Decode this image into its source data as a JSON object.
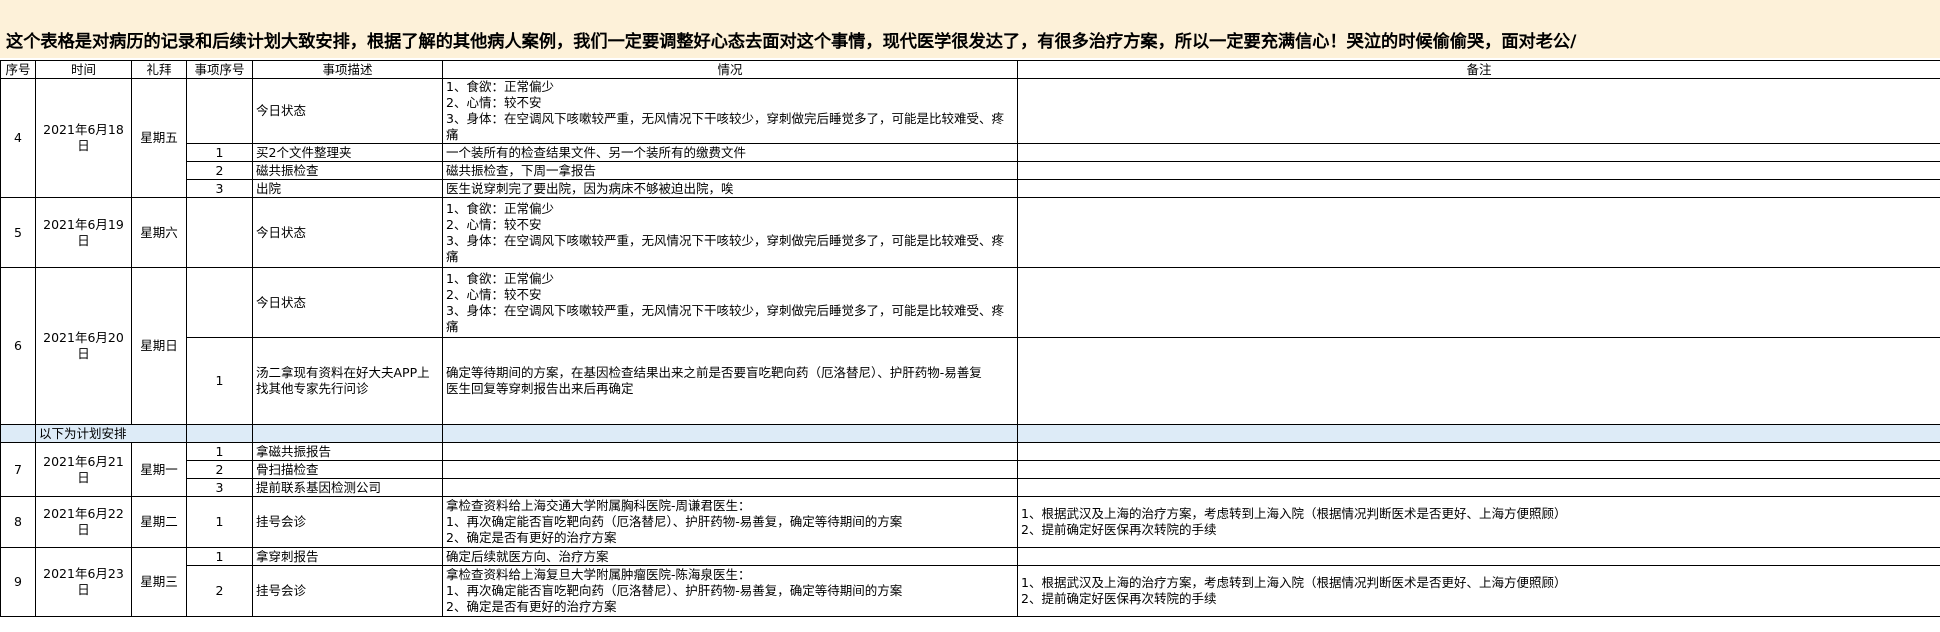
{
  "banner": {
    "text": "这个表格是对病历的记录和后续计划大致安排，根据了解的其他病人案例，我们一定要调整好心态去面对这个事情，现代医学很发达了，有很多治疗方案，所以一定要充满信心！哭泣的时候偷偷哭，面对老公/\n老爸的时候一定要开心、信心满满的姿态！"
  },
  "table": {
    "headers": [
      "序号",
      "时间",
      "礼拜",
      "事项序号",
      "事项描述",
      "情况",
      "备注"
    ],
    "plan_label": "以下为计划安排",
    "day4": {
      "no": "4",
      "date": "2021年6月18日",
      "week": "星期五",
      "r1": {
        "seq": "",
        "desc": "今日状态",
        "info": "1、食欲：正常偏少\n2、心情：较不安\n3、身体：在空调风下咳嗽较严重，无风情况下干咳较少，穿刺做完后睡觉多了，可能是比较难受、疼痛",
        "note": ""
      },
      "r2": {
        "seq": "1",
        "desc": "买2个文件整理夹",
        "info": "一个装所有的检查结果文件、另一个装所有的缴费文件",
        "note": ""
      },
      "r3": {
        "seq": "2",
        "desc": "磁共振检查",
        "info": "磁共振检查，下周一拿报告",
        "note": ""
      },
      "r4": {
        "seq": "3",
        "desc": "出院",
        "info": "医生说穿刺完了要出院，因为病床不够被迫出院，唉",
        "note": ""
      }
    },
    "day5": {
      "no": "5",
      "date": "2021年6月19日",
      "week": "星期六",
      "r1": {
        "seq": "",
        "desc": "今日状态",
        "info": "1、食欲：正常偏少\n2、心情：较不安\n3、身体：在空调风下咳嗽较严重，无风情况下干咳较少，穿刺做完后睡觉多了，可能是比较难受、疼痛",
        "note": ""
      }
    },
    "day6": {
      "no": "6",
      "date": "2021年6月20日",
      "week": "星期日",
      "r1": {
        "seq": "",
        "desc": "今日状态",
        "info": "1、食欲：正常偏少\n2、心情：较不安\n3、身体：在空调风下咳嗽较严重，无风情况下干咳较少，穿刺做完后睡觉多了，可能是比较难受、疼痛",
        "note": ""
      },
      "r2": {
        "seq": "1",
        "desc": "汤二拿现有资料在好大夫APP上找其他专家先行问诊",
        "info": "确定等待期间的方案，在基因检查结果出来之前是否要盲吃靶向药（厄洛替尼）、护肝药物-易善复\n医生回复等穿刺报告出来后再确定",
        "note": ""
      }
    },
    "day7": {
      "no": "7",
      "date": "2021年6月21日",
      "week": "星期一",
      "r1": {
        "seq": "1",
        "desc": "拿磁共振报告",
        "info": "",
        "note": ""
      },
      "r2": {
        "seq": "2",
        "desc": "骨扫描检查",
        "info": "",
        "note": ""
      },
      "r3": {
        "seq": "3",
        "desc": "提前联系基因检测公司",
        "info": "",
        "note": ""
      }
    },
    "day8": {
      "no": "8",
      "date": "2021年6月22日",
      "week": "星期二",
      "r1": {
        "seq": "1",
        "desc": "挂号会诊",
        "info": "拿检查资料给上海交通大学附属胸科医院-周谦君医生：\n1、再次确定能否盲吃靶向药（厄洛替尼）、护肝药物-易善复，确定等待期间的方案\n2、确定是否有更好的治疗方案",
        "note": "1、根据武汉及上海的治疗方案，考虑转到上海入院（根据情况判断医术是否更好、上海方便照顾）\n2、提前确定好医保再次转院的手续"
      }
    },
    "day9": {
      "no": "9",
      "date": "2021年6月23日",
      "week": "星期三",
      "r1": {
        "seq": "1",
        "desc": "拿穿刺报告",
        "info": "确定后续就医方向、治疗方案",
        "note": ""
      },
      "r2": {
        "seq": "2",
        "desc": "挂号会诊",
        "info": "拿检查资料给上海复旦大学附属肿瘤医院-陈海泉医生：\n1、再次确定能否盲吃靶向药（厄洛替尼）、护肝药物-易善复，确定等待期间的方案\n2、确定是否有更好的治疗方案",
        "note": "1、根据武汉及上海的治疗方案，考虑转到上海入院（根据情况判断医术是否更好、上海方便照顾）\n2、提前确定好医保再次转院的手续"
      }
    }
  }
}
